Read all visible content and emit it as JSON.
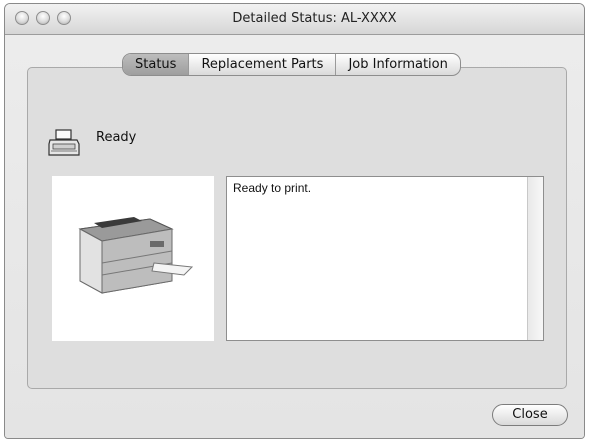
{
  "window": {
    "title": "Detailed Status: AL-XXXX"
  },
  "tabs": [
    {
      "label": "Status",
      "active": true
    },
    {
      "label": "Replacement Parts",
      "active": false
    },
    {
      "label": "Job Information",
      "active": false
    }
  ],
  "status": {
    "icon": "printer-status-icon",
    "text": "Ready"
  },
  "message": {
    "text": "Ready to print."
  },
  "buttons": {
    "close_label": "Close"
  }
}
